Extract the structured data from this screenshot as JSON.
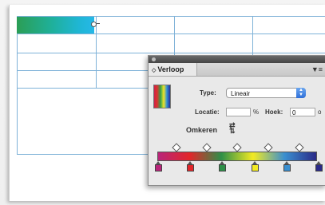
{
  "panel": {
    "tab_label": "Verloop",
    "tab_icon": "tab-collapse-icon",
    "menu_icon": "panel-menu-icon",
    "type_label": "Type:",
    "type_value": "Lineair",
    "location_label": "Locatie:",
    "location_value": "",
    "location_unit": "%",
    "angle_label": "Hoek:",
    "angle_value": "0",
    "angle_unit": "o",
    "reverse_label": "Omkeren",
    "reverse_icon": "reverse-gradient-icon",
    "gradient_stops": [
      {
        "color": "#b8257a"
      },
      {
        "color": "#e2262a"
      },
      {
        "color": "#2e8f48"
      },
      {
        "color": "#f2ea23"
      },
      {
        "color": "#3a8fd0"
      },
      {
        "color": "#2a2a88"
      }
    ]
  },
  "table": {
    "selected_cell_gradient": [
      "#2b9e55",
      "#1fb6d4",
      "#26b8e8"
    ],
    "border_color": "#7fb2d8"
  }
}
